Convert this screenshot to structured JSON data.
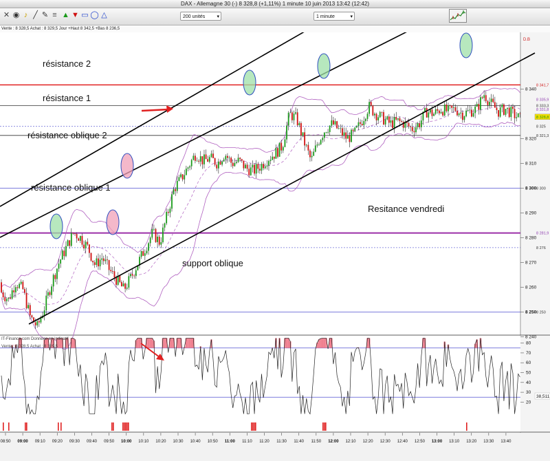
{
  "window": {
    "title": "DAX - Allemagne 30 (-)    8 328,8 (+1,11%)    1 minute   10 juin 2013 13:42 (12:42)"
  },
  "toolbar": {
    "icons": [
      "x-tool-icon",
      "eye-icon",
      "bell-icon",
      "line-tool-icon",
      "pencil-icon",
      "fibonacci-icon",
      "arrow-up-icon",
      "arrow-down-icon",
      "rectangle-icon",
      "ellipse-icon",
      "triangle-icon"
    ],
    "units_select": "200 unités",
    "interval_select": "1 minute",
    "chart_type_icon": "chart-thumbnail-icon"
  },
  "info": "Vente : 8 328,5 Achat : 8 329,5 Jour  +Haut 8 342,5 +Bas 8 236,5",
  "annotations": {
    "resistance2": "résistance 2",
    "resistance1": "résistance 1",
    "oblique2": "résistance oblique 2",
    "oblique1": "résistance oblique 1",
    "vendredi": "Resitance vendredi",
    "support": "support oblique"
  },
  "price_axis": {
    "ticks": [
      "8 340",
      "8 320",
      "8 310",
      "8 300",
      "8 290",
      "8 280",
      "8 270",
      "8 260",
      "8 250",
      "8 240"
    ],
    "line_labels": [
      "8 341,7",
      "8 333,3",
      "8 335,9",
      "8 331,8",
      "8 328,8",
      "8 325",
      "8 321,3",
      "8 300",
      "8 281,9",
      "8 276",
      "8 250"
    ],
    "db_label": "D.B"
  },
  "osc": {
    "watermark": "IT-Finance.com   Données en indicatif",
    "info": "Vente : 8 328,5 Achat : 8 329,5",
    "ticks": [
      "80",
      "70",
      "60",
      "50",
      "40",
      "30",
      "20"
    ],
    "value": "38,511"
  },
  "time_axis": [
    "08:50",
    "09:00",
    "09:10",
    "09:20",
    "09:30",
    "09:40",
    "09:50",
    "10:00",
    "10:10",
    "10:20",
    "10:30",
    "10:40",
    "10:50",
    "11:00",
    "11:10",
    "11:20",
    "11:30",
    "11:40",
    "11:50",
    "12:00",
    "12:10",
    "12:20",
    "12:30",
    "12:40",
    "12:50",
    "13:00",
    "13:10",
    "13:20",
    "13:30",
    "13:40"
  ],
  "bold_times": [
    "09:00",
    "10:00",
    "11:00",
    "12:00",
    "13:00"
  ],
  "colors": {
    "red_line": "#e02020",
    "purple_line": "#9b2fa8",
    "blue_line": "#5050d0",
    "bullish": "#1a9a1a",
    "bearish": "#d01010",
    "bands": "#b060c0"
  },
  "chart_data": {
    "type": "line",
    "title": "DAX - Allemagne 30",
    "interval": "1 minute",
    "ohlc_close_approx": [
      8258,
      8255,
      8262,
      8259,
      8248,
      8244,
      8252,
      8262,
      8270,
      8276,
      8282,
      8280,
      8276,
      8269,
      8272,
      8267,
      8263,
      8259,
      8264,
      8270,
      8276,
      8282,
      8278,
      8289,
      8300,
      8304,
      8309,
      8314,
      8311,
      8312,
      8310,
      8314,
      8310,
      8311,
      8308,
      8307,
      8309,
      8312,
      8314,
      8317,
      8330,
      8328,
      8319,
      8311,
      8319,
      8324,
      8326,
      8323,
      8320,
      8322,
      8327,
      8333,
      8330,
      8328,
      8326,
      8327,
      8326,
      8324,
      8326,
      8331,
      8330,
      8332,
      8331,
      8332,
      8330,
      8331,
      8332,
      8338,
      8334,
      8331,
      8332,
      8330,
      8328
    ],
    "overlays": [
      "Bollinger bands",
      "dashed moving average"
    ],
    "horizontal_levels": [
      8341.7,
      8333.3,
      8325,
      8321.3,
      8300,
      8281.9,
      8276,
      8250
    ],
    "oscillator_range": [
      0,
      85
    ],
    "oscillator_levels": [
      75,
      25
    ]
  }
}
